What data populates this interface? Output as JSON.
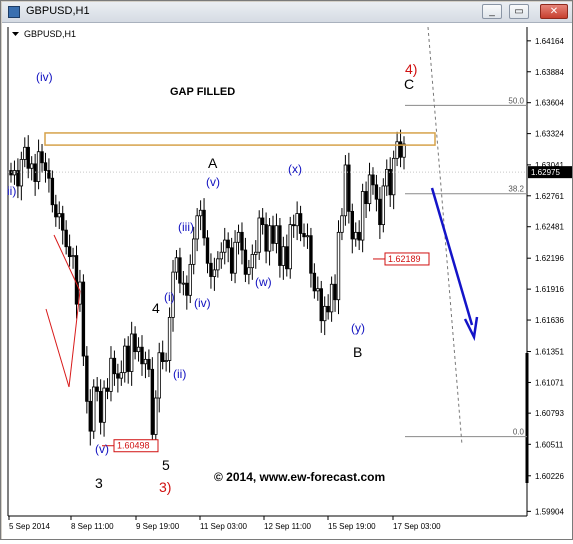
{
  "window": {
    "title": "GBPUSD,H1",
    "chart_label": "GBPUSD,H1",
    "buttons": {
      "minimize": "_",
      "restore": "▭",
      "close": "✕"
    }
  },
  "chart_data": {
    "type": "candlestick",
    "title": "GBPUSD,H1",
    "annotation_title": "GAP FILLED",
    "copyright": "© 2014, www.ew-forecast.com",
    "ylim": [
      1.5988,
      1.6409
    ],
    "y_ticks": [
      1.59904,
      1.60226,
      1.60511,
      1.60793,
      1.61071,
      1.61351,
      1.61636,
      1.61916,
      1.62196,
      1.62481,
      1.62761,
      1.63041,
      1.63324,
      1.63604,
      1.63884,
      1.64164
    ],
    "y_tick_labels": [
      "1.59904",
      "1.60226",
      "1.60511",
      "1.60793",
      "1.61071",
      "1.61351",
      "1.61636",
      "1.61916",
      "1.62196",
      "1.62481",
      "1.62761",
      "1.63041",
      "1.63324",
      "1.63604",
      "1.63884",
      "1.64164"
    ],
    "x_tick_labels": [
      "5 Sep 2014",
      "8 Sep 11:00",
      "9 Sep 19:00",
      "11 Sep 03:00",
      "12 Sep 11:00",
      "15 Sep 19:00",
      "17 Sep 03:00"
    ],
    "current_price": "1.62975",
    "price_labels": [
      {
        "text": "1.62189",
        "price": 1.62189
      },
      {
        "text": "1.60498",
        "price": 1.60498
      }
    ],
    "fibonacci": [
      {
        "level": "50.0",
        "price": 1.6358
      },
      {
        "level": "38.2",
        "price": 1.6278
      },
      {
        "level": "0.0",
        "price": 1.6058
      }
    ],
    "gap_zone": {
      "low": 1.6322,
      "high": 1.6333
    },
    "series_close": [
      1.6295,
      1.6299,
      1.6285,
      1.6309,
      1.632,
      1.6301,
      1.6305,
      1.6289,
      1.6316,
      1.6306,
      1.6299,
      1.6292,
      1.6268,
      1.6257,
      1.626,
      1.6245,
      1.623,
      1.6221,
      1.6222,
      1.6178,
      1.6198,
      1.6131,
      1.609,
      1.6063,
      1.6103,
      1.6099,
      1.6071,
      1.6102,
      1.6099,
      1.6129,
      1.6115,
      1.6111,
      1.6116,
      1.614,
      1.6117,
      1.6151,
      1.6135,
      1.6139,
      1.6124,
      1.6128,
      1.6119,
      1.606,
      1.6093,
      1.6134,
      1.6126,
      1.6127,
      1.6166,
      1.6207,
      1.622,
      1.6197,
      1.6197,
      1.6186,
      1.6214,
      1.6237,
      1.6258,
      1.6263,
      1.6238,
      1.6215,
      1.6203,
      1.6209,
      1.6219,
      1.6225,
      1.6236,
      1.6229,
      1.6206,
      1.6234,
      1.6243,
      1.6227,
      1.6205,
      1.6211,
      1.6223,
      1.6225,
      1.6256,
      1.625,
      1.6226,
      1.6249,
      1.6233,
      1.6249,
      1.6213,
      1.623,
      1.621,
      1.625,
      1.6249,
      1.626,
      1.6242,
      1.6239,
      1.624,
      1.6206,
      1.619,
      1.6192,
      1.6163,
      1.6176,
      1.6171,
      1.6196,
      1.6182,
      1.6243,
      1.6258,
      1.6304,
      1.6262,
      1.6237,
      1.6243,
      1.6236,
      1.628,
      1.6269,
      1.6295,
      1.6286,
      1.6273,
      1.625,
      1.6285,
      1.63,
      1.6277,
      1.631,
      1.6325,
      1.6311,
      1.6323
    ],
    "wave_labels": [
      {
        "text": "(iv)",
        "color": "#1010c0"
      },
      {
        "text": "ii)",
        "color": "#1010c0"
      },
      {
        "text": "(iii)",
        "color": "#1010c0"
      },
      {
        "text": "(v)",
        "color": "#1010c0"
      },
      {
        "text": "(x)",
        "color": "#1010c0"
      },
      {
        "text": "(i)",
        "color": "#1010c0"
      },
      {
        "text": "(iv)",
        "color": "#1010c0"
      },
      {
        "text": "(w)",
        "color": "#1010c0"
      },
      {
        "text": "(ii)",
        "color": "#1010c0"
      },
      {
        "text": "(y)",
        "color": "#1010c0"
      },
      {
        "text": "(v)",
        "color": "#1010c0"
      },
      {
        "text": "A",
        "color": "#000000"
      },
      {
        "text": "B",
        "color": "#000000"
      },
      {
        "text": "C",
        "color": "#000000"
      },
      {
        "text": "4",
        "color": "#000000"
      },
      {
        "text": "5",
        "color": "#000000"
      },
      {
        "text": "3",
        "color": "#000000"
      },
      {
        "text": "4)",
        "color": "#d01010"
      },
      {
        "text": "3)",
        "color": "#d01010"
      }
    ],
    "colors": {
      "candle": "#000000",
      "axis": "#000000",
      "gap_zone": "#d6a24a",
      "fibo": "#8a8a8a",
      "wave_blue": "#1010c0",
      "wave_red": "#d01010",
      "triangle_lines": "#d81a1a",
      "forecast_arrow": "#1414c8",
      "price_label": "#d01010"
    },
    "grid": false
  }
}
